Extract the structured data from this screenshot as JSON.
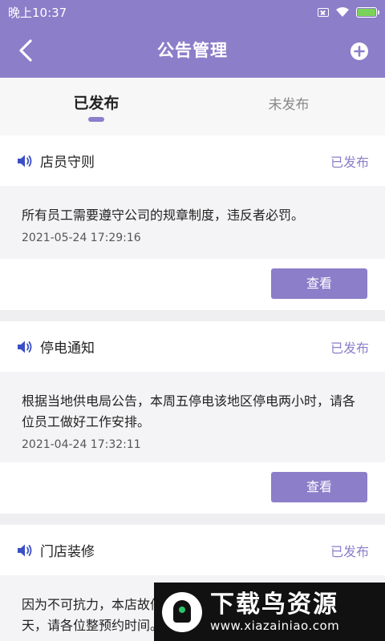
{
  "statusbar": {
    "time": "晚上10:37"
  },
  "navbar": {
    "title": "公告管理"
  },
  "tabs": [
    {
      "label": "已发布"
    },
    {
      "label": "未发布"
    }
  ],
  "colors": {
    "accent": "#8c7ec9",
    "background": "#efeff1"
  },
  "announcements": [
    {
      "title": "店员守则",
      "status": "已发布",
      "content": "所有员工需要遵守公司的规章制度，违反者必罚。",
      "date": "2021-05-24 17:29:16",
      "button": "查看"
    },
    {
      "title": "停电通知",
      "status": "已发布",
      "content": "根据当地供电局公告，本周五停电该地区停电两小时，请各位员工做好工作安排。",
      "date": "2021-04-24 17:32:11",
      "button": "查看"
    },
    {
      "title": "门店装修",
      "status": "已发布",
      "content": "因为不可抗力，本店故停业一天，请各位整预约时间。",
      "date": "",
      "button": ""
    }
  ],
  "watermark": {
    "title": "下载鸟资源",
    "url": "www.xiazainiao.com"
  }
}
